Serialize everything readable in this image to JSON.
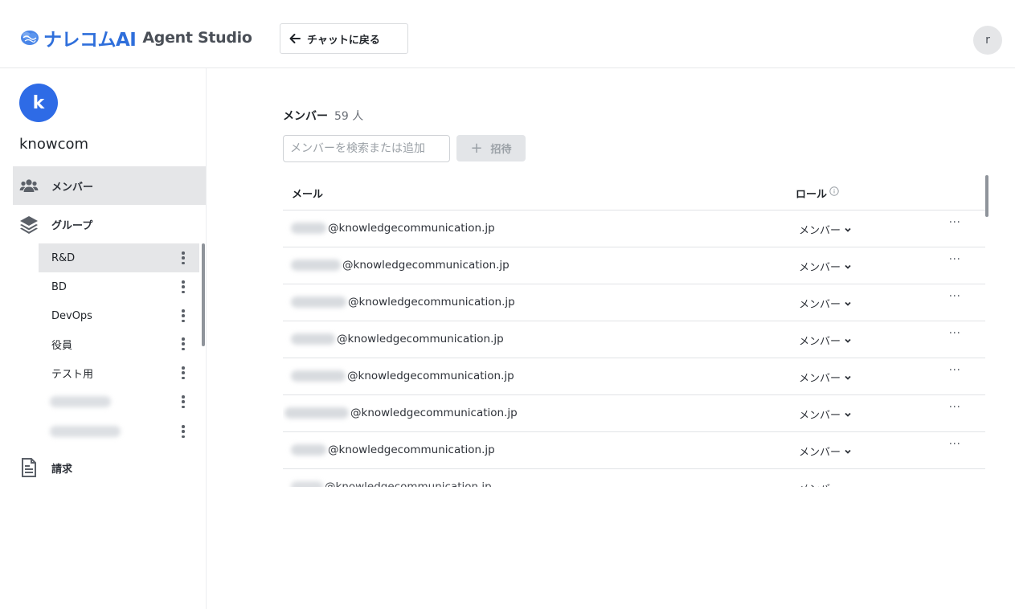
{
  "header": {
    "logo_jp": "ナレコムAI",
    "logo_en": "Agent Studio",
    "back_button_label": "チャットに戻る",
    "user_avatar_initial": "r",
    "colors": {
      "brand": "#2f6fdb"
    }
  },
  "sidebar": {
    "org_initial": "k",
    "org_name": "knowcom",
    "nav": {
      "members": {
        "label": "メンバー",
        "icon": "users-icon"
      },
      "groups": {
        "label": "グループ",
        "icon": "layers-icon"
      },
      "billing": {
        "label": "請求",
        "icon": "document-icon"
      }
    },
    "groups": [
      {
        "label": "R&D"
      },
      {
        "label": "BD"
      },
      {
        "label": "DevOps"
      },
      {
        "label": "役員"
      },
      {
        "label": "テスト用"
      },
      {
        "label": ""
      },
      {
        "label": ""
      }
    ]
  },
  "main": {
    "title": "メンバー",
    "count": "59 人",
    "search": {
      "placeholder": "メンバーを検索または追加",
      "value": ""
    },
    "invite_label": "招待",
    "table": {
      "col_email": "メール",
      "col_role": "ロール",
      "rows": [
        {
          "domain": "@knowledgecommunication.jp",
          "role": "メンバー"
        },
        {
          "domain": "@knowledgecommunication.jp",
          "role": "メンバー"
        },
        {
          "domain": "@knowledgecommunication.jp",
          "role": "メンバー"
        },
        {
          "domain": "@knowledgecommunication.jp",
          "role": "メンバー"
        },
        {
          "domain": "@knowledgecommunication.jp",
          "role": "メンバー"
        },
        {
          "domain": "@knowledgecommunication.jp",
          "role": "メンバー"
        },
        {
          "domain": "@knowledgecommunication.jp",
          "role": "メンバー"
        },
        {
          "domain": "@knowledgecommunication.jp",
          "role": "メンバー"
        }
      ],
      "row_more_label": "···"
    }
  }
}
